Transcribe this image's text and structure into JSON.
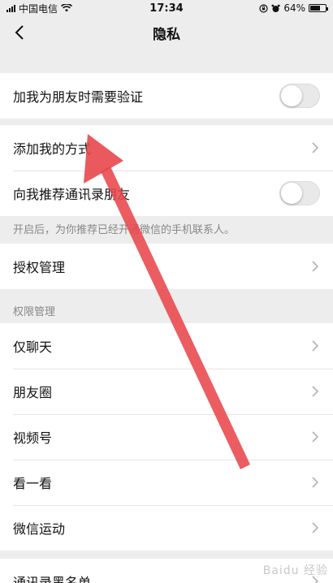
{
  "status_bar": {
    "carrier": "中国电信",
    "time": "17:34",
    "battery": "64%",
    "battery_level": 0.64,
    "icons": [
      "signal-icon",
      "wifi-icon",
      "rotation-lock-icon",
      "alarm-icon",
      "battery-icon"
    ]
  },
  "nav": {
    "title": "隐私",
    "back_icon": "chevron-left-icon"
  },
  "groups": {
    "verify": {
      "label": "加我为朋友时需要验证",
      "toggle_on": false
    },
    "add_me": {
      "label": "添加我的方式"
    },
    "recommend": {
      "label": "向我推荐通讯录朋友",
      "toggle_on": false
    },
    "recommend_hint": "开启后，为你推荐已经开通微信的手机联系人。",
    "auth": {
      "label": "授权管理"
    },
    "permissions_header": "权限管理",
    "permissions": [
      {
        "label": "仅聊天"
      },
      {
        "label": "朋友圈"
      },
      {
        "label": "视频号"
      },
      {
        "label": "看一看"
      },
      {
        "label": "微信运动"
      }
    ],
    "blacklist": {
      "label": "通讯录黑名单"
    }
  },
  "annotation": {
    "color": "#e8474b"
  },
  "colors": {
    "background": "#ededed",
    "cell": "#ffffff",
    "toggle_off": "#e9e9ea"
  },
  "watermark": "Baidu 经验"
}
